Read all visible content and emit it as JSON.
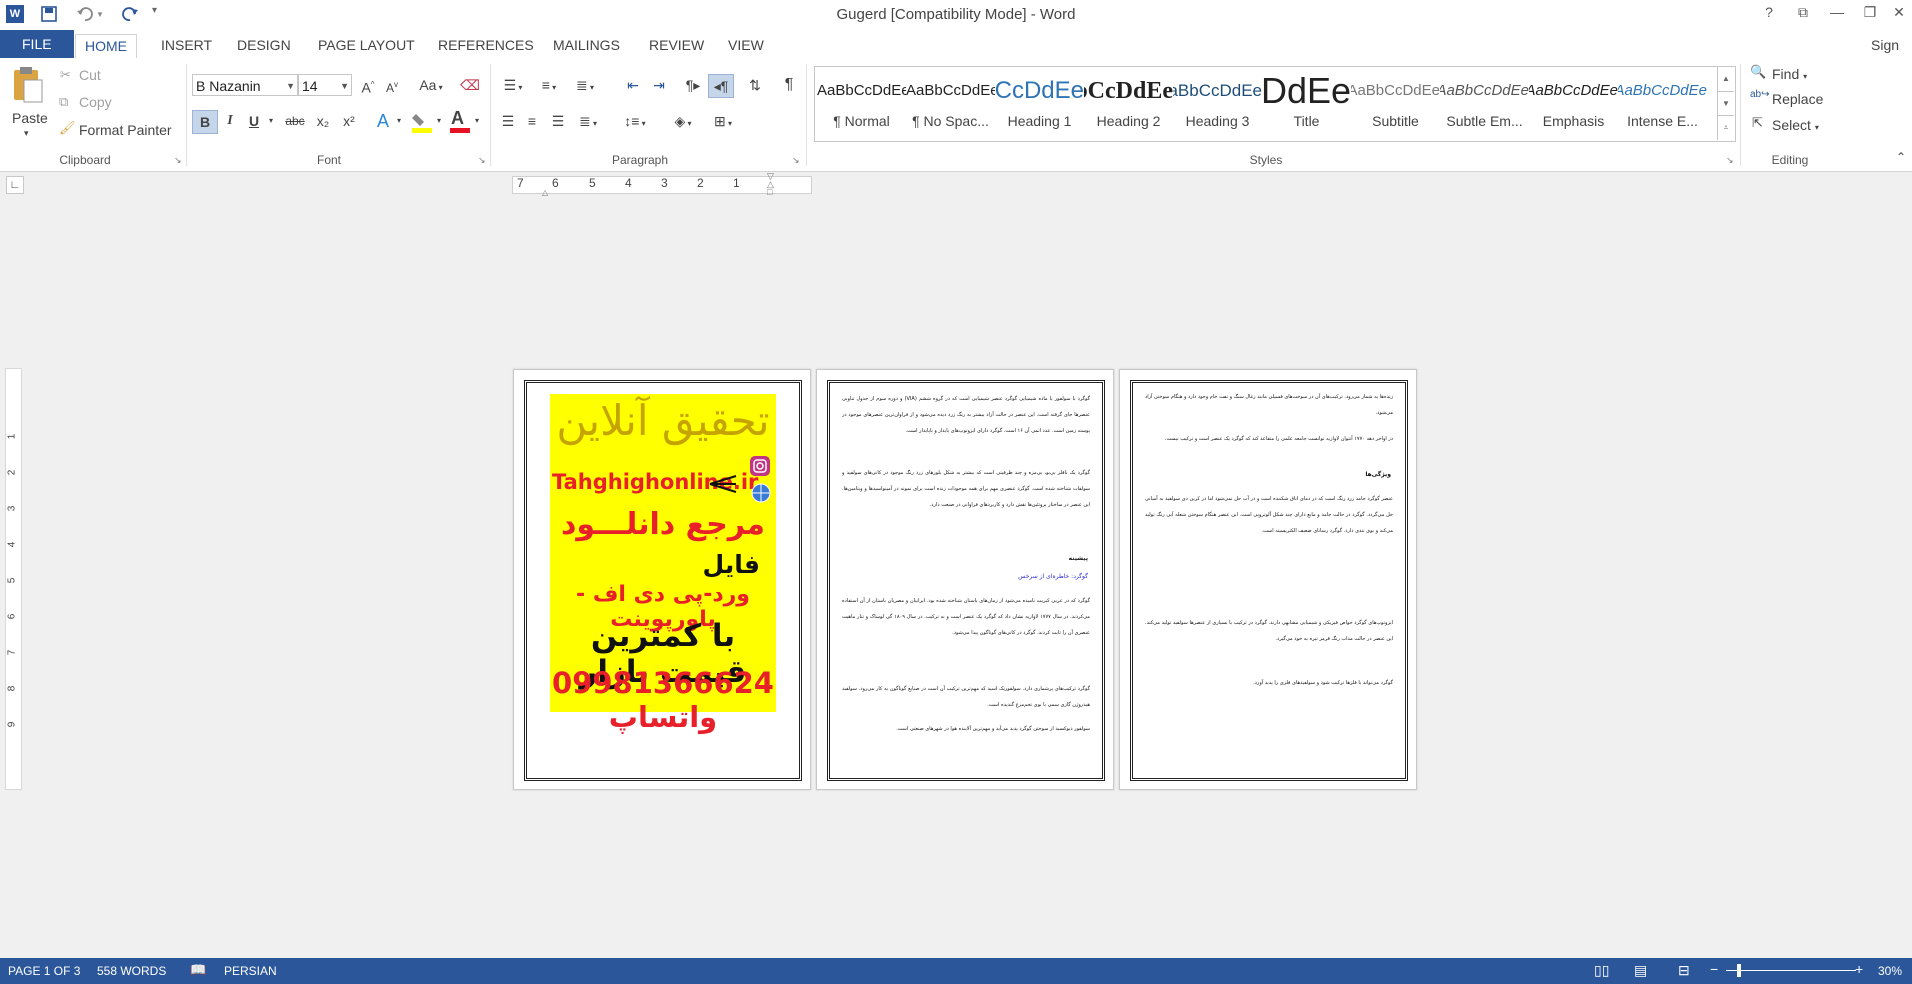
{
  "window": {
    "title": "Gugerd [Compatibility Mode] - Word",
    "help": "?",
    "ribbon_display": "⧉",
    "minimize": "—",
    "restore": "❐",
    "close": "✕",
    "sign_in": "Sign i"
  },
  "tabs": [
    "FILE",
    "HOME",
    "INSERT",
    "DESIGN",
    "PAGE LAYOUT",
    "REFERENCES",
    "MAILINGS",
    "REVIEW",
    "VIEW"
  ],
  "clipboard": {
    "paste": "Paste",
    "cut": "Cut",
    "copy": "Copy",
    "format_painter": "Format Painter",
    "group_label": "Clipboard"
  },
  "font": {
    "family": "B Nazanin",
    "size": "14",
    "grow": "A",
    "shrink": "A",
    "change_case": "Aa",
    "bold": "B",
    "italic": "I",
    "underline": "U",
    "strike": "abc",
    "subscript": "x₂",
    "superscript": "x²",
    "text_effects": "A",
    "font_color": "A",
    "group_label": "Font",
    "highlight_color": "#ffff00",
    "font_color_value": "#e81123"
  },
  "paragraph": {
    "group_label": "Paragraph"
  },
  "styles": {
    "items": [
      {
        "sample": "AaBbCcDdEe",
        "name": "¶ Normal"
      },
      {
        "sample": "AaBbCcDdEe",
        "name": "¶ No Spac..."
      },
      {
        "sample": "AaBbCcDdEe",
        "name": "Heading 1"
      },
      {
        "sample": "AaBbCcDdEe",
        "name": "Heading 2"
      },
      {
        "sample": "AaBbCcDdEe",
        "name": "Heading 3"
      },
      {
        "sample": "AaBbCcDdEe",
        "name": "Title"
      },
      {
        "sample": "AaBbCcDdEe",
        "name": "Subtitle"
      },
      {
        "sample": "AaBbCcDdEe",
        "name": "Subtle Em..."
      },
      {
        "sample": "AaBbCcDdEe",
        "name": "Emphasis"
      },
      {
        "sample": "AaBbCcDdEe",
        "name": "Intense E..."
      }
    ],
    "group_label": "Styles"
  },
  "editing": {
    "find": "Find",
    "replace": "Replace",
    "select": "Select",
    "group_label": "Editing"
  },
  "ruler": {
    "numbers": [
      "7",
      "6",
      "5",
      "4",
      "3",
      "2",
      "1"
    ],
    "vertical_numbers": [
      "1",
      "2",
      "3",
      "4",
      "5",
      "6",
      "7",
      "8",
      "9"
    ]
  },
  "document": {
    "ad": {
      "headline": "تحقیق آنلاین",
      "site": "Tahghighonline.ir",
      "line3": "مرجع دانلـــود",
      "line4": "فایل",
      "line5": "ورد-پی دی اف - پاورپوینت",
      "line6": "با کمترین قیمت بازار",
      "line7": "09981366624 واتساپ"
    },
    "page2": {
      "para1": "گوگرد با سولفور یا ماده شیمیایی گوگرد عنصر شیمیایی است که در گروه ششم (VIA) و دوره سوم از جدول تناوبی عنصرها جای گرفته است. این عنصر در حالت آزاد بیشتر به رنگ زرد دیده می‌شود و از فراوان‌ترین عنصرهای موجود در پوسته زمین است. عدد اتمی آن ۱۶ است. گوگرد دارای ایزوتوپ‌های پایدار و ناپایدار است.",
      "para2": "گوگرد یک نافلز بی‌بو، بی‌مزه و چند ظرفیتی است که بیشتر به شکل بلورهای زرد رنگ موجود در کانی‌های سولفید و سولفات شناخته شده است. گوگرد عنصری مهم برای همه موجودات زنده است برای نمونه در آمینواسیدها و ویتامین‌ها. این عنصر در ساختار پروتئین‌ها نقش دارد و کاربردهای فراوانی در صنعت دارد.",
      "heading": "پیشینه",
      "sub": "گوگرد: خاطره‌ای از سرخس",
      "para3": "گوگرد که در عربی کبریت نامیده می‌شود از زمان‌های باستان شناخته شده بود. ایرانیان و مصریان باستان از آن استفاده می‌کردند. در سال ۱۷۷۷ لاوازیه نشان داد که گوگرد یک عنصر است و نه ترکیب. در سال ۱۸۰۹ گی لوساک و تنار ماهیت عنصری آن را ثابت کردند. گوگرد در کانی‌های گوناگون پیدا می‌شود.",
      "para4": "گوگرد ترکیب‌های پرشماری دارد. سولفوریک اسید که مهم‌ترین ترکیب آن است در صنایع گوناگون به کار می‌رود. سولفید هیدروژن گازی سمی با بوی تخم‌مرغ گندیده است.",
      "para5": "سولفور دیوکسید از سوختن گوگرد پدید می‌آید و مهم‌ترین آلاینده هوا در شهرهای صنعتی است."
    },
    "page3": {
      "para1": "زنده‌ها به شمار می‌رود. ترکیب‌های آن در سوخت‌های فسیلی مانند زغال سنگ و نفت خام وجود دارد و هنگام سوختن آزاد می‌شود.",
      "para2": "در اواخر دهه ۱۷۷۰ آنتوان لاوازیه توانست جامعه علمی را متقاعد کند که گوگرد یک عنصر است و ترکیب نیست.",
      "heading": "ویژگی‌ها",
      "para3": "عنصر گوگرد جامد زرد رنگ است که در دمای اتاق شکننده است و در آب حل نمی‌شود اما در کربن دی سولفید به آسانی حل می‌گردد. گوگرد در حالت جامد و مایع دارای چند شکل آلوتروپی است. این عنصر هنگام سوختن شعله آبی رنگ تولید می‌کند و بوی تندی دارد. گوگرد رسانای ضعیف الکتریسیته است.",
      "para4": "ایزوتوپ‌های گوگرد خواص فیزیکی و شیمیایی مشابهی دارند. گوگرد در ترکیب با بسیاری از عنصرها سولفید تولید می‌کند. این عنصر در حالت مذاب رنگ قرمز تیره به خود می‌گیرد.",
      "para5": "گوگرد می‌تواند با فلزها ترکیب شود و سولفیدهای فلزی را پدید آورد."
    },
    "page1_blank": ""
  },
  "status": {
    "page": "PAGE 1 OF 3",
    "words": "558 WORDS",
    "language": "PERSIAN",
    "zoom": "30%"
  },
  "colors": {
    "accent": "#2b579a",
    "status_bar": "#2b579a"
  }
}
